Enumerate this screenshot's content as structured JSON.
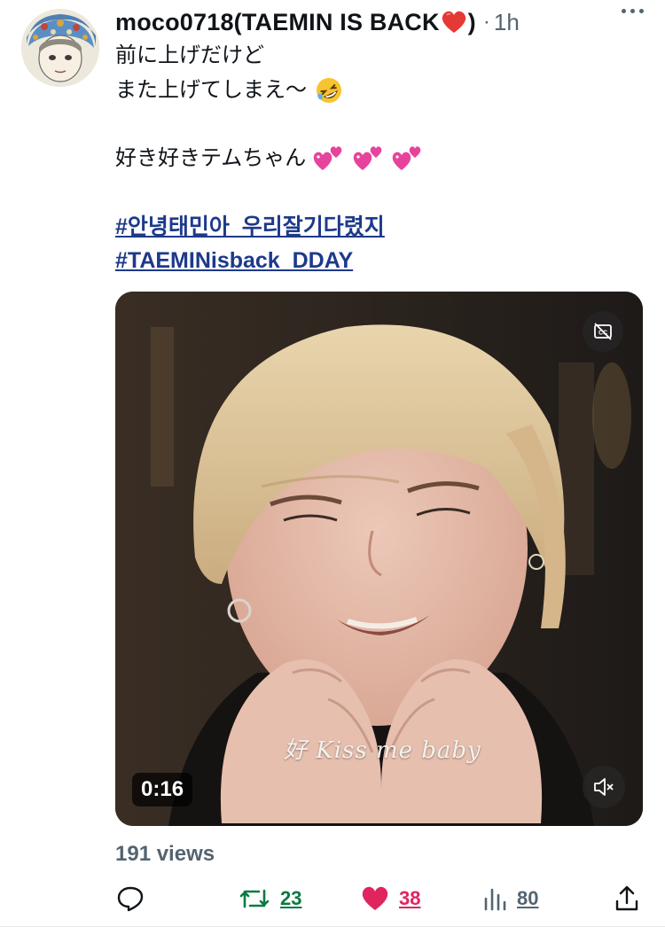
{
  "tweet": {
    "display_name": "moco0718(TAEMIN IS BACK",
    "display_name_close": ")",
    "time_sep": "·",
    "time": "1h",
    "lines": {
      "l1": "前に上げだけど",
      "l2": "また上げてしまえ～",
      "l4": "好き好きテムちゃん",
      "h1": "#안녕태민아_우리잘기다렸지",
      "h2": "#TAEMINisback_DDAY"
    },
    "emoji_names": [
      "rolling-on-the-floor-laughing",
      "two-hearts",
      "two-hearts",
      "two-hearts"
    ]
  },
  "media": {
    "duration": "0:16",
    "subtitle": "好 Kiss me baby",
    "cc_icon": "closed-captions-off-icon",
    "mute_icon": "speaker-muted-icon"
  },
  "stats": {
    "views": "191 views",
    "retweets": "23",
    "likes": "38",
    "view_count": "80"
  },
  "colors": {
    "text": "#0f1419",
    "secondary": "#536471",
    "link": "#1d3a8a",
    "retweet": "#0a7a42",
    "like": "#e0245e"
  }
}
